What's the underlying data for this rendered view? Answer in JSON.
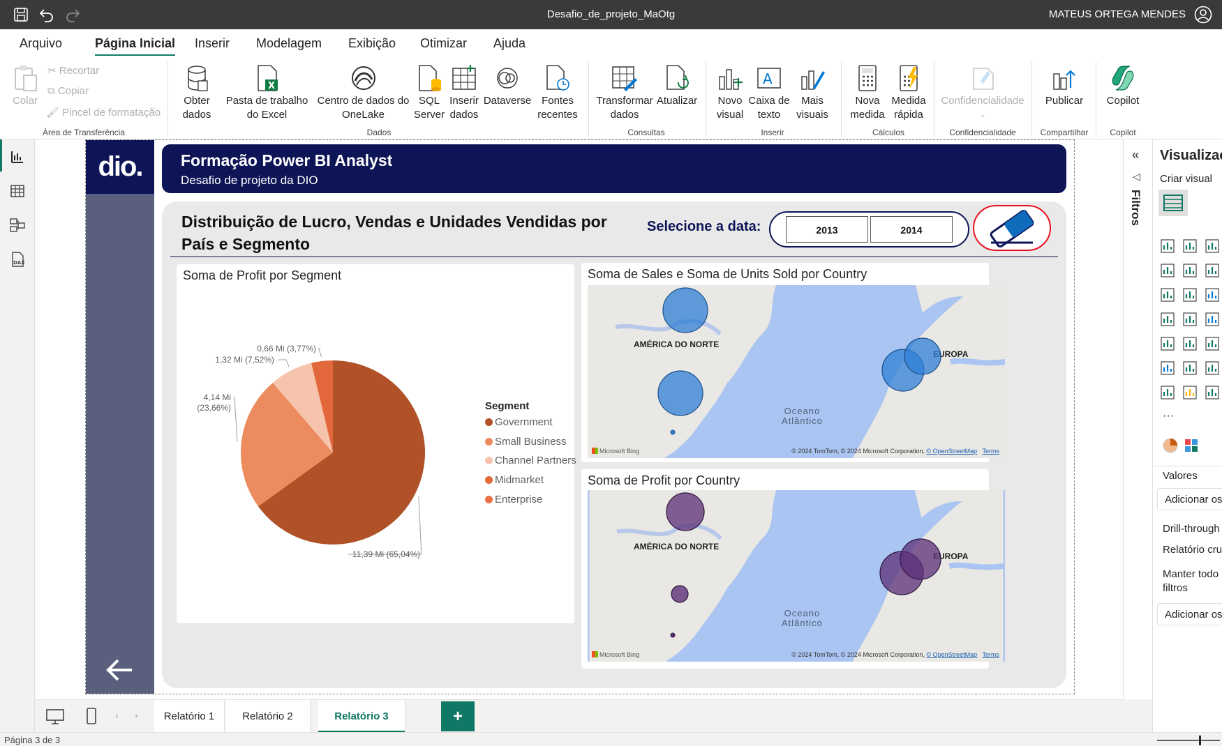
{
  "window": {
    "title": "Desafio_de_projeto_MaOtg",
    "user": "MATEUS ORTEGA MENDES"
  },
  "menu": [
    "Arquivo",
    "Página Inicial",
    "Inserir",
    "Modelagem",
    "Exibição",
    "Otimizar",
    "Ajuda"
  ],
  "ribbon": {
    "clipboard": {
      "paste": "Colar",
      "cut": "Recortar",
      "copy": "Copiar",
      "format_painter": "Pincel de formatação",
      "group": "Área de Transferência"
    },
    "data": {
      "get_data": "Obter dados",
      "excel": "Pasta de trabalho do Excel",
      "onelake": "Centro de dados do OneLake",
      "sql": "SQL Server",
      "enter_data": "Inserir dados",
      "dataverse": "Dataverse",
      "recent": "Fontes recentes",
      "group": "Dados"
    },
    "queries": {
      "transform": "Transformar dados",
      "refresh": "Atualizar",
      "group": "Consultas"
    },
    "insert": {
      "new_visual": "Novo visual",
      "text_box": "Caixa de texto",
      "more_visuals": "Mais visuais",
      "group": "Inserir"
    },
    "calc": {
      "new_measure": "Nova medida",
      "quick_measure": "Medida rápida",
      "group": "Cálculos"
    },
    "sensitivity": {
      "label": "Confidencialidade",
      "group": "Confidencialidade"
    },
    "share": {
      "publish": "Publicar",
      "group": "Compartilhar"
    },
    "copilot": {
      "label": "Copilot",
      "group": "Copilot"
    }
  },
  "report": {
    "logo": "dio.",
    "header_title": "Formação Power BI Analyst",
    "header_subtitle": "Desafio de projeto da DIO",
    "main_title_line1": "Distribuição de Lucro, Vendas e Unidades Vendidas por",
    "main_title_line2": "País e Segmento",
    "date_label": "Selecione a data:",
    "years": [
      "2013",
      "2014"
    ]
  },
  "pie": {
    "title": "Soma de Profit por Segment",
    "legend_title": "Segment",
    "segments": [
      {
        "name": "Government",
        "value": 11.39,
        "pct": 65.04,
        "label": "11,39 Mi (65,04%)",
        "color": "#b05128"
      },
      {
        "name": "Small Business",
        "value": 4.14,
        "pct": 23.66,
        "label": "4,14 Mi",
        "label2": "(23,66%)",
        "color": "#ec8c5e"
      },
      {
        "name": "Channel Partners",
        "value": 1.32,
        "pct": 7.52,
        "label": "1,32 Mi (7,52%)",
        "color": "#f6c4ac"
      },
      {
        "name": "Midmarket",
        "value": 0.66,
        "pct": 3.77,
        "label": "0,66 Mi (3,77%)",
        "color": "#e2673a"
      },
      {
        "name": "Enterprise",
        "value": 0.0,
        "pct": 0.0,
        "label": "",
        "color": "#ec7043"
      }
    ]
  },
  "map1": {
    "title": "Soma de Sales e Soma de Units Sold por Country",
    "bubble_color": "#2f7fd6"
  },
  "map2": {
    "title": "Soma de Profit por Country",
    "bubble_color": "#5b2f77"
  },
  "map_common": {
    "na_label": "AMÉRICA DO NORTE",
    "eu_label": "EUROPA",
    "ocean_label_1": "Oceano",
    "ocean_label_2": "Atlântico",
    "bing": "Microsoft Bing",
    "copyright": "© 2024 TomTom, © 2024 Microsoft Corporation,",
    "osm": "© OpenStreetMap",
    "terms": "Terms"
  },
  "filters_label": "Filtros",
  "viz_pane": {
    "title": "Visualizaç",
    "build": "Criar visual",
    "values": "Valores",
    "add_fields": "Adicionar os",
    "drill": "Drill-through",
    "cross_report": "Relatório cru",
    "keep_filters_1": "Manter todo",
    "keep_filters_2": "filtros",
    "add_fields_2": "Adicionar os"
  },
  "pages": [
    "Relatório 1",
    "Relatório 2",
    "Relatório 3"
  ],
  "add_page": "+",
  "status": "Página 3 de 3"
}
